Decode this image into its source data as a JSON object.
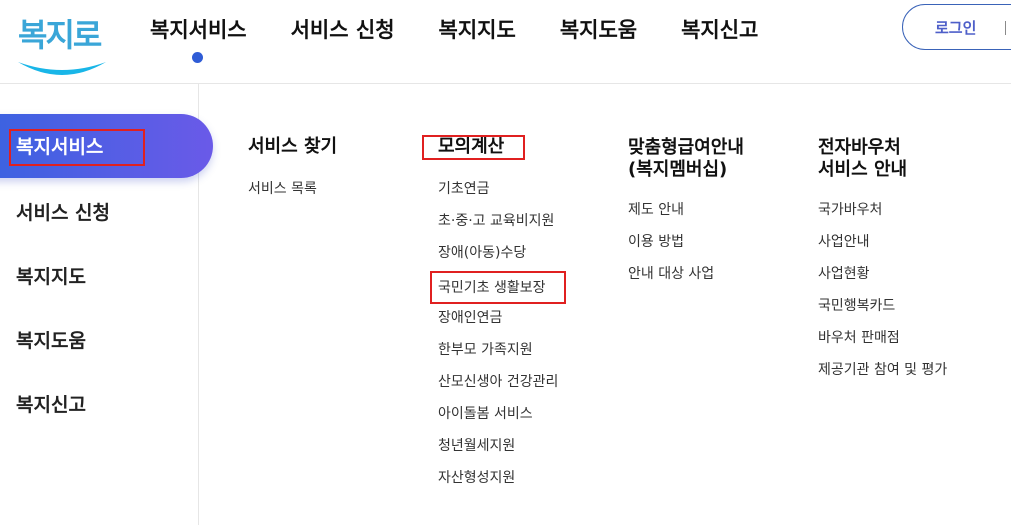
{
  "logo": {
    "text": "복지로"
  },
  "colors": {
    "accent_blue": "#2f5cd6",
    "active_gradient_start": "#3763e0",
    "active_gradient_end": "#6a5ae8",
    "highlight_red": "#e02020",
    "login_text": "#4e5fc9"
  },
  "gnb": {
    "items": [
      {
        "label": "복지서비스",
        "active": true
      },
      {
        "label": "서비스 신청",
        "active": false
      },
      {
        "label": "복지지도",
        "active": false
      },
      {
        "label": "복지도움",
        "active": false
      },
      {
        "label": "복지신고",
        "active": false
      }
    ]
  },
  "header": {
    "login_label": "로그인"
  },
  "sidebar": {
    "items": [
      {
        "label": "복지서비스",
        "active": true
      },
      {
        "label": "서비스 신청",
        "active": false
      },
      {
        "label": "복지지도",
        "active": false
      },
      {
        "label": "복지도움",
        "active": false
      },
      {
        "label": "복지신고",
        "active": false
      }
    ]
  },
  "megamenu": {
    "columns": [
      {
        "title": "서비스 찾기",
        "links": [
          "서비스 목록"
        ]
      },
      {
        "title": "모의계산",
        "links": [
          "기초연금",
          "초·중·고 교육비지원",
          "장애(아동)수당",
          "국민기초 생활보장",
          "장애인연금",
          "한부모 가족지원",
          "산모신생아 건강관리",
          "아이돌봄 서비스",
          "청년월세지원",
          "자산형성지원"
        ]
      },
      {
        "title_lines": [
          "맞춤형급여안내",
          "(복지멤버십)"
        ],
        "links": [
          "제도 안내",
          "이용 방법",
          "안내 대상 사업"
        ]
      },
      {
        "title_lines": [
          "전자바우처",
          "서비스 안내"
        ],
        "links": [
          "국가바우처",
          "사업안내",
          "사업현황",
          "국민행복카드",
          "바우처 판매점",
          "제공기관 참여 및 평가"
        ]
      }
    ]
  }
}
